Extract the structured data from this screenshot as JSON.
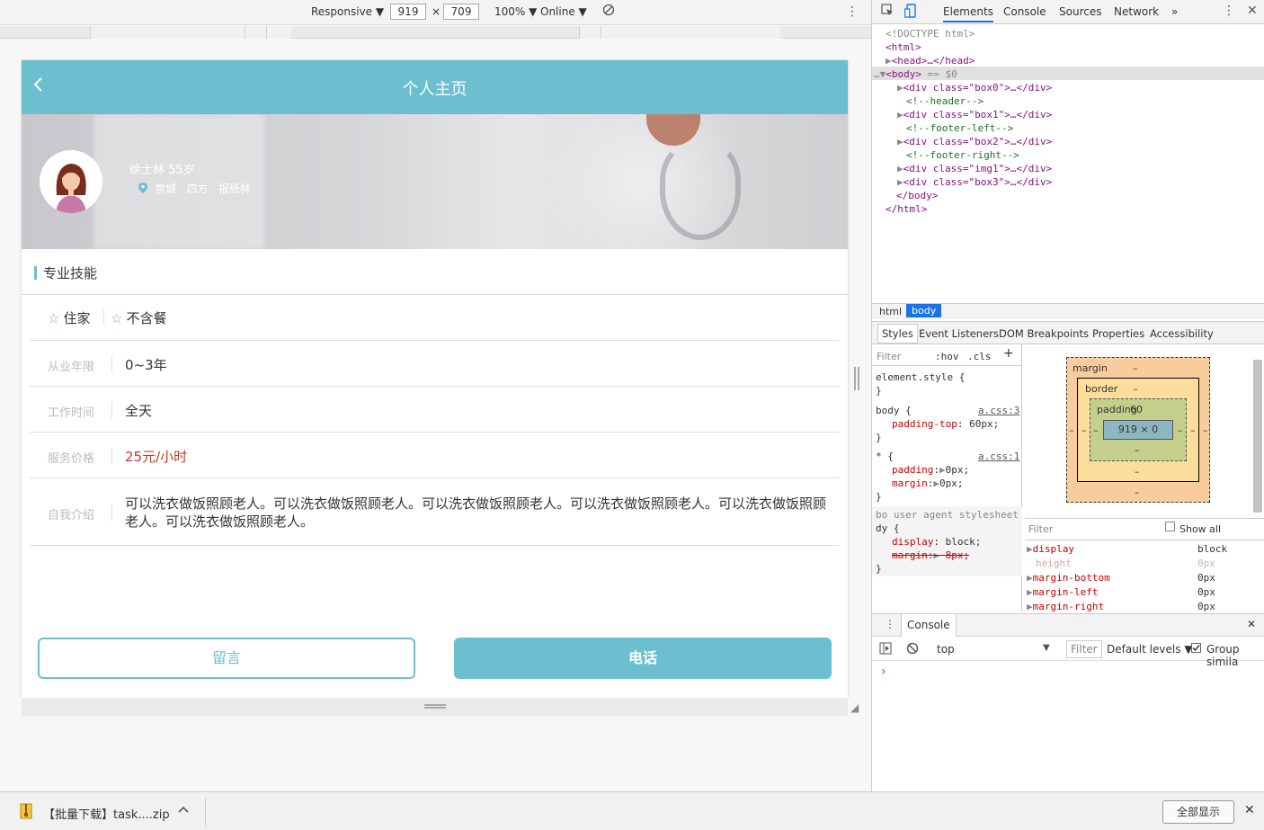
{
  "devtools_bar": {
    "device": "Responsive ▼",
    "width": "919",
    "times": "×",
    "height": "709",
    "zoom": "100% ▼",
    "network": "Online ▼"
  },
  "app": {
    "header_title": "个人主页",
    "profile_name": "徐士林 55岁",
    "profile_location": "京城 · 四方 · 报纸林",
    "section_title": "专业技能",
    "tags": [
      "住家",
      "不含餐"
    ],
    "rows": {
      "years_label": "从业年限",
      "years_value": "0~3年",
      "time_label": "工作时间",
      "time_value": "全天",
      "price_label": "服务价格",
      "price_value": "25元/小时",
      "intro_label": "自我介绍",
      "intro_value": "可以洗衣做饭照顾老人。可以洗衣做饭照顾老人。可以洗衣做饭照顾老人。可以洗衣做饭照顾老人。可以洗衣做饭照顾老人。可以洗衣做饭照顾老人。"
    },
    "buttons": {
      "message": "留言",
      "call": "电话"
    },
    "colors": {
      "accent": "#6bbfcf",
      "price": "#c0392b"
    }
  },
  "devtools": {
    "tabs": [
      "Elements",
      "Console",
      "Sources",
      "Network",
      "»"
    ],
    "dom": {
      "doctype": "<!DOCTYPE html>",
      "html_open": "<html>",
      "head": "<head>…</head>",
      "body_open": "<body>",
      "body_selected": "== $0",
      "box0": "<div class=\"box0\">…</div>",
      "comment_header": "<!--header-->",
      "box1": "<div class=\"box1\">…</div>",
      "comment_footer_left": "<!--footer-left-->",
      "box2": "<div class=\"box2\">…</div>",
      "comment_footer_right": "<!--footer-right-->",
      "img1": "<div class=\"img1\">…</div>",
      "box3": "<div class=\"box3\">…</div>",
      "body_close": "</body>",
      "html_close": "</html>"
    },
    "breadcrumbs": [
      "html",
      "body"
    ],
    "subtabs": [
      "Styles",
      "Event Listeners",
      "DOM Breakpoints",
      "Properties",
      "Accessibility"
    ],
    "styles": {
      "filter": "Filter",
      "hov": ":hov",
      "cls": ".cls",
      "plus": "+",
      "element_style": "element.style {",
      "close_brace": "}",
      "body_rule": "body {",
      "body_src": "a.css:3",
      "padding_top_prop": "padding-top",
      "padding_top_val": "60px;",
      "star_rule": "* {",
      "star_src": "a.css:1",
      "padding_prop": "padding",
      "padding_val": "0px;",
      "margin_prop": "margin",
      "margin_val": "0px;",
      "ua_line1": "bo  user agent stylesheet",
      "ua_line2": "dy {",
      "display_prop": "display",
      "display_val": "block;",
      "ua_margin": "margin:",
      "ua_margin_val": "8px;"
    },
    "box_model": {
      "margin": "margin",
      "border": "border",
      "padding": "padding",
      "padding_val": "60",
      "content": "919 × 0",
      "dash": "–"
    },
    "computed": {
      "filter": "Filter",
      "show_all": "Show all",
      "props": [
        {
          "name": "display",
          "value": "block"
        },
        {
          "name": "height",
          "value": "0px"
        },
        {
          "name": "margin-bottom",
          "value": "0px"
        },
        {
          "name": "margin-left",
          "value": "0px"
        },
        {
          "name": "margin-right",
          "value": "0px"
        }
      ]
    },
    "console": {
      "tab": "Console",
      "context": "top",
      "filter": "Filter",
      "levels": "Default levels ▼",
      "group": "Group simila",
      "prompt": "›"
    }
  },
  "download_bar": {
    "file_name": "【批量下载】task....zip",
    "show_all": "全部显示"
  }
}
